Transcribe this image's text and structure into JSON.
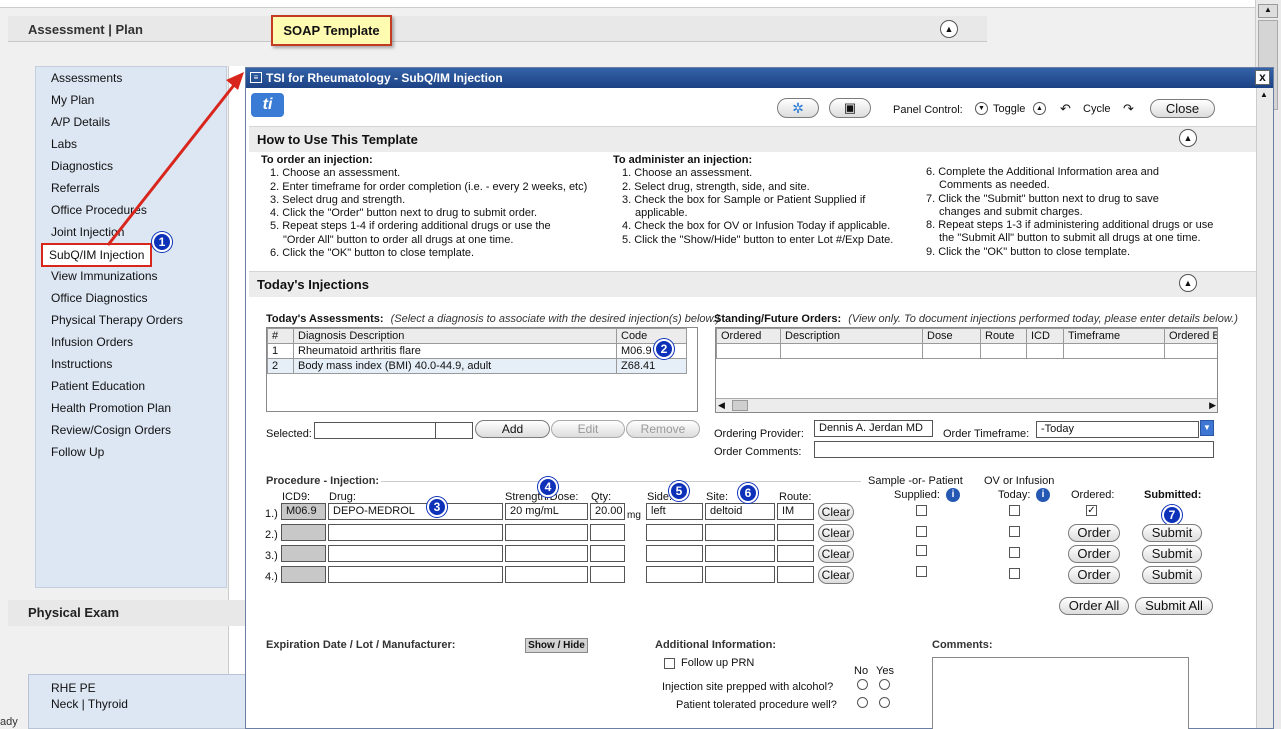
{
  "background": {
    "header": "Assessment | Plan",
    "soap_label": "SOAP Template",
    "nav_items": [
      "Assessments",
      "My Plan",
      "A/P Details",
      "Labs",
      "Diagnostics",
      "Referrals",
      "Office Procedures",
      "Joint Injection",
      "SubQ/IM Injection",
      "View Immunizations",
      "Office Diagnostics",
      "Physical Therapy Orders",
      "Infusion Orders",
      "Instructions",
      "Patient Education",
      "Health Promotion Plan",
      "Review/Cosign Orders",
      "Follow Up"
    ],
    "physical_exam": "Physical Exam",
    "pe_items": [
      "RHE PE",
      "Neck | Thyroid"
    ],
    "status_text": "ady"
  },
  "dialog": {
    "title": "TSI for Rheumatology - SubQ/IM Injection",
    "close_x": "x",
    "panel_control": "Panel Control:",
    "toggle": "Toggle",
    "cycle": "Cycle",
    "close_label": "Close",
    "how_to_title": "How to Use This Template",
    "order_heading": "To order an injection:",
    "order_steps": [
      "1. Choose an assessment.",
      "2. Enter timeframe for order completion (i.e. - every 2 weeks, etc)",
      "3. Select drug and strength.",
      "4. Click the \"Order\" button next to drug to submit order.",
      "5. Repeat steps 1-4 if ordering additional drugs or use the",
      "\"Order All\" button to order all drugs at one time.",
      "6. Click the \"OK\" button to close template."
    ],
    "admin_heading": "To administer an injection:",
    "admin_steps": [
      "1. Choose an assessment.",
      "2. Select drug, strength, side, and site.",
      "3. Check the box for Sample or Patient Supplied if",
      "applicable.",
      "4. Check the box for OV or Infusion Today if applicable.",
      "5. Click the \"Show/Hide\" button to enter Lot #/Exp Date."
    ],
    "more_steps": [
      "6. Complete the Additional Information area and",
      "Comments as needed.",
      "7. Click the \"Submit\" button next to drug to save",
      "changes and submit charges.",
      "8. Repeat steps 1-3 if administering additional drugs or use",
      "the \"Submit All\" button to submit all drugs at one time.",
      "9. Click the \"OK\" button to close template."
    ],
    "todays_title": "Today's Injections",
    "assess_label": "Today's Assessments:",
    "assess_hint": "(Select a diagnosis to associate with the desired injection(s) below.)",
    "assess_cols": [
      "#",
      "Diagnosis Description",
      "Code"
    ],
    "assess_rows": [
      [
        "1",
        "Rheumatoid arthritis flare",
        "M06.9"
      ],
      [
        "2",
        "Body mass index (BMI) 40.0-44.9, adult",
        "Z68.41"
      ]
    ],
    "selected_label": "Selected:",
    "add": "Add",
    "edit": "Edit",
    "remove": "Remove",
    "standing_label": "Standing/Future Orders:",
    "standing_hint": "(View only. To document injections performed today, please enter details below.)",
    "standing_cols": [
      "Ordered",
      "Description",
      "Dose",
      "Route",
      "ICD",
      "Timeframe",
      "Ordered B"
    ],
    "provider_label": "Ordering Provider:",
    "provider_value": "Dennis A. Jerdan MD",
    "timeframe_label": "Order Timeframe:",
    "timeframe_value": "-Today",
    "comments_order_label": "Order Comments:",
    "proc_label": "Procedure - Injection:",
    "col_icd": "ICD9:",
    "col_drug": "Drug:",
    "col_strength": "Strength/Dose:",
    "col_qty": "Qty:",
    "col_side": "Side:",
    "col_site": "Site:",
    "col_route": "Route:",
    "sample_label": "Sample -or- Patient",
    "supplied_label": "Supplied:",
    "ov_label": "OV or Infusion",
    "today_label": "Today:",
    "ordered_label": "Ordered:",
    "submitted_label": "Submitted:",
    "rows": [
      {
        "num": "1.)",
        "icd": "M06.9",
        "drug": "DEPO-MEDROL",
        "strength": "20 mg/mL",
        "qty": "20.00",
        "unit": "mg",
        "side": "left",
        "site": "deltoid",
        "route": "IM"
      },
      {
        "num": "2.)",
        "icd": "",
        "drug": "",
        "strength": "",
        "qty": "",
        "unit": "",
        "side": "",
        "site": "",
        "route": ""
      },
      {
        "num": "3.)",
        "icd": "",
        "drug": "",
        "strength": "",
        "qty": "",
        "unit": "",
        "side": "",
        "site": "",
        "route": ""
      },
      {
        "num": "4.)",
        "icd": "",
        "drug": "",
        "strength": "",
        "qty": "",
        "unit": "",
        "side": "",
        "site": "",
        "route": ""
      }
    ],
    "clear": "Clear",
    "order": "Order",
    "submit": "Submit",
    "order_all": "Order All",
    "submit_all": "Submit All",
    "exp_label": "Expiration Date / Lot / Manufacturer:",
    "show_hide": "Show / Hide",
    "addl_label": "Additional Information:",
    "follow_up": "Follow up PRN",
    "no": "No",
    "yes": "Yes",
    "q1": "Injection site prepped with alcohol?",
    "q2": "Patient tolerated procedure well?",
    "comments_label": "Comments:",
    "info_glyph": "i"
  },
  "callouts": [
    "1",
    "2",
    "3",
    "4",
    "5",
    "6",
    "7"
  ],
  "colors": {
    "title_bar": "#1c4284",
    "nav_bg": "#dde6f3",
    "highlight": "#d9261c",
    "callout": "#0d31b8",
    "soap_bg": "#fffbb0"
  }
}
